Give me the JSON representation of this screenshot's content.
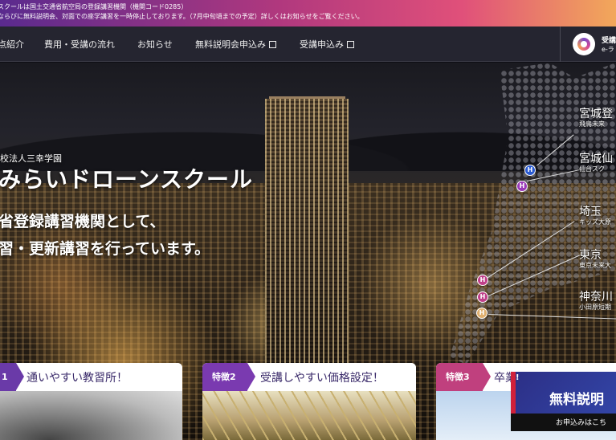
{
  "notice": {
    "line1": "スクールは国土交通省航空局の登録講習機関（機関コード0285）",
    "line2": "ならびに無料説明会、対面での座学講習を一時停止しております。（7月中旬頃までの予定）詳しくはお知らせをご覧ください。"
  },
  "nav": {
    "items": [
      "点紹介",
      "費用・受講の流れ",
      "お知らせ",
      "無料説明会申込み",
      "受講申込み"
    ],
    "elearning": {
      "line1": "受講",
      "line2": "e-ラ"
    }
  },
  "hero": {
    "sub": "校法人三幸学園",
    "title": "みらいドローンスクール",
    "line1": "省登録講習機関として、",
    "line2": "習・更新講習を行っています。"
  },
  "map": {
    "labels": [
      {
        "name": "宮城登",
        "sub": "飛鳥未来"
      },
      {
        "name": "宮城仙",
        "sub": "仙台スク"
      },
      {
        "name": "埼玉",
        "sub": "キッズ大原"
      },
      {
        "name": "東京",
        "sub": "東京未来大"
      },
      {
        "name": "神奈川",
        "sub": "小田原短期"
      }
    ],
    "pin_letter": "H",
    "colors": {
      "pin_blue": "#2a5ad0",
      "pin_purple": "#9a3ab8",
      "pin_pink": "#c0408a",
      "pin_gold": "#e0b070"
    }
  },
  "features": [
    {
      "tag": "1",
      "title": "通いやすい教習所！",
      "color": "#6a3aa8"
    },
    {
      "tag": "特徴2",
      "title": "受講しやすい価格設定！",
      "color": "#7a3ab0"
    },
    {
      "tag": "特徴3",
      "title": "卒業",
      "color": "#c0407e"
    }
  ],
  "banner": {
    "title": "無料説明",
    "sub": "お申込みはこち",
    "mark": "!"
  }
}
